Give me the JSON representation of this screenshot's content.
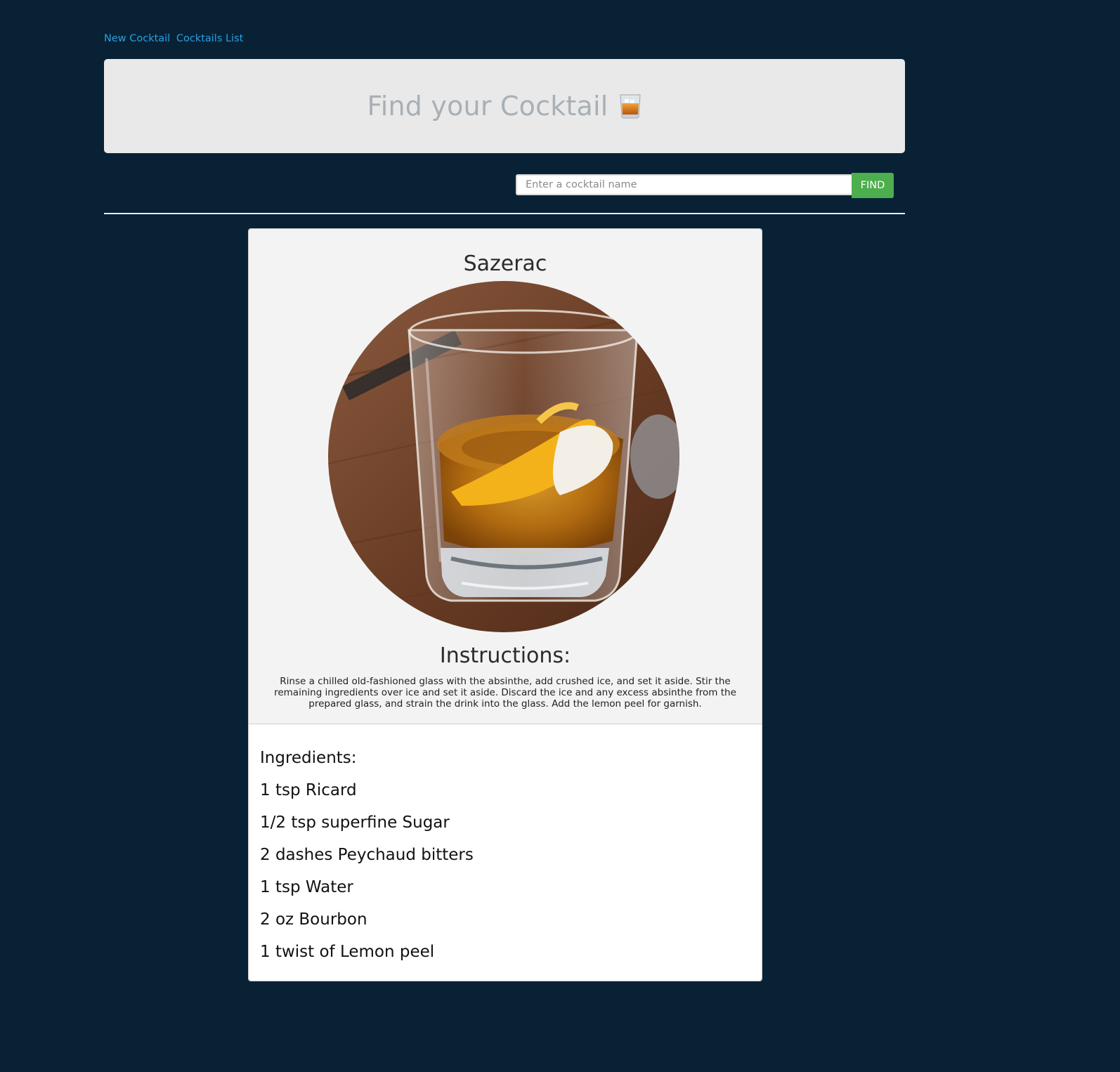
{
  "nav": {
    "links": [
      "New Cocktail",
      "Cocktails List"
    ]
  },
  "hero": {
    "title": "Find your Cocktail",
    "icon": "tumbler-glass-icon"
  },
  "search": {
    "placeholder": "Enter a cocktail name",
    "value": "",
    "button_label": "FIND",
    "button_color": "#4cae4c"
  },
  "cocktail": {
    "name": "Sazerac",
    "instructions_heading": "Instructions:",
    "instructions": "Rinse a chilled old-fashioned glass with the absinthe, add crushed ice, and set it aside. Stir the remaining ingredients over ice and set it aside. Discard the ice and any excess absinthe from the prepared glass, and strain the drink into the glass. Add the lemon peel for garnish.",
    "ingredients_heading": "Ingredients:",
    "ingredients": [
      "1 tsp Ricard",
      "1/2 tsp superfine Sugar",
      "2 dashes Peychaud bitters",
      "1 tsp Water",
      "2 oz Bourbon",
      "1 twist of Lemon peel"
    ]
  },
  "colors": {
    "background": "#082135",
    "link": "#2a9fe0",
    "hero_bg": "#e9e9e9",
    "hero_text": "#a8b0b6"
  }
}
